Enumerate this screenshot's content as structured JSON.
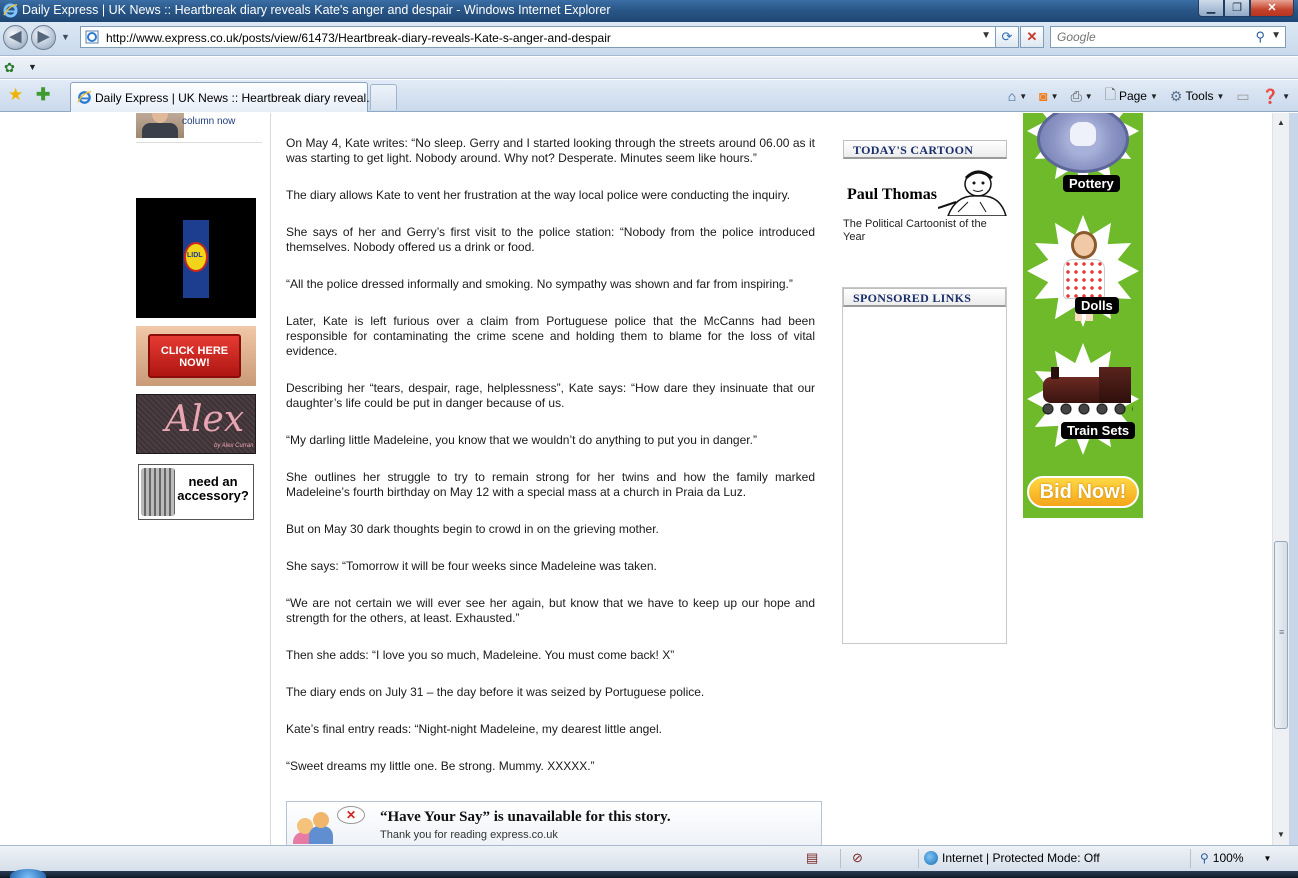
{
  "window": {
    "title": "Daily Express | UK News :: Heartbreak diary reveals Kate's anger and despair - Windows Internet Explorer",
    "minimize": "▁",
    "maximize": "❐",
    "close": "✕"
  },
  "navbar": {
    "back": "◀",
    "forward": "▶",
    "url": "http://www.express.co.uk/posts/view/61473/Heartbreak-diary-reveals-Kate-s-anger-and-despair",
    "search_placeholder": "Google"
  },
  "tabbar": {
    "tab_label": "Daily Express | UK News :: Heartbreak diary reveal...",
    "commands": {
      "page": "Page",
      "tools": "Tools"
    }
  },
  "sidebar": {
    "columnist_label": "column now",
    "ads": {
      "click_here": "CLICK HERE NOW!",
      "alex": "Alex",
      "alex_sub": "by Alex Curran",
      "accessory": "need an accessory?",
      "lidl": "LIDL"
    }
  },
  "article": {
    "paragraphs": [
      "On May 4, Kate writes: “No sleep. Gerry and I started looking through the streets around 06.00 as it was starting to get light. Nobody around. Why not? Desperate. Minutes seem like hours.”",
      "The diary allows Kate to vent her frustration at the way local police were conducting the inquiry.",
      "She says of her and Gerry’s first visit to the police station: “Nobody from the police introduced themselves. Nobody offered us a drink or food.",
      "“All the police dressed informally and smoking. No sympathy was shown and far from inspiring.”",
      "Later, Kate is left furious over a claim from Portuguese police that the McCanns had been responsible for contaminating the crime scene and holding them to blame for the loss of vital evidence.",
      "Describing her “tears, despair, rage, helplessness”, Kate says: “How dare they insinuate that our daughter’s life could be put in danger because of us.",
      "“My darling little Madeleine, you know that we wouldn’t do anything to put you in danger.”",
      "She outlines her struggle to try to remain strong for her twins and how the family marked Madeleine’s fourth birthday on May 12 with a special mass at a church in Praia da Luz.",
      "But on May 30 dark thoughts begin to crowd in on the grieving mother.",
      "She says: “Tomorrow it will be four weeks since Madeleine was taken.",
      "“We are not certain we will ever see her again, but know that we have to keep up our hope and strength for the others, at least. Exhausted.”",
      "Then she adds: “I love you so much, Madeleine. You must come back! X”",
      "The diary ends on July 31 – the day before it was seized by Portuguese police.",
      "Kate’s final entry reads:  “Night-night Madeleine, my dearest little angel.",
      "“Sweet dreams my little one. Be strong. Mummy. XXXXX.”"
    ],
    "have_your_say": {
      "headline": "“Have Your Say” is unavailable for this story.",
      "sub": "Thank you for reading express.co.uk"
    }
  },
  "right": {
    "cartoon_heading": "TODAY'S CARTOON",
    "cartoonist": "Paul Thomas",
    "cartoonist_desc": "The Political Cartoonist of the Year",
    "sponsored_heading": "SPONSORED LINKS",
    "ebay": {
      "items": [
        "Pottery",
        "Dolls",
        "Train Sets"
      ],
      "cta": "Bid Now!"
    }
  },
  "status": {
    "zone": "Internet | Protected Mode: Off",
    "zoom": "100%"
  },
  "colors": {
    "title_bar": "#2a5788",
    "link_blue": "#1e3d7b",
    "ebay_green": "#6fba2b"
  }
}
